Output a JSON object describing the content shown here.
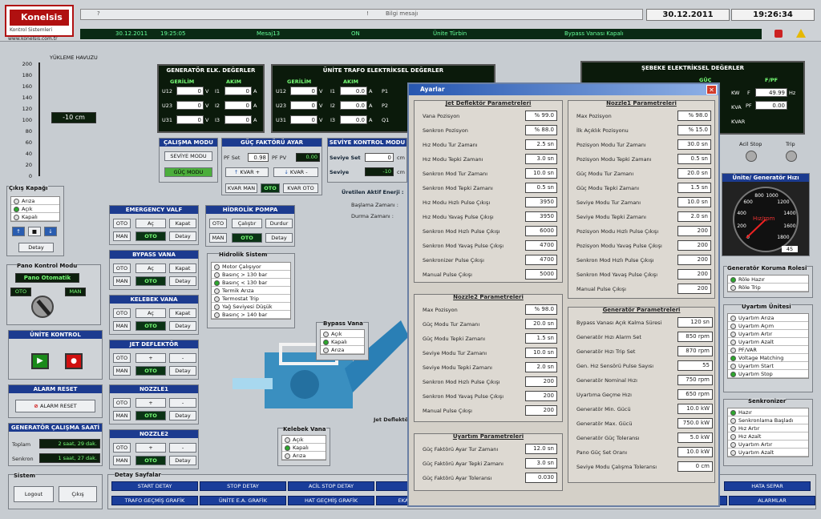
{
  "header": {
    "logo": "Konelsis",
    "logo_sub": "Kontrol Sistemleri",
    "website": "www.konelsis.com.tr",
    "message": "Bilgi mesajı",
    "date": "30.12.2011",
    "time": "19:26:34"
  },
  "alarmbar": {
    "date": "30.12.2011",
    "time": "19:25:05",
    "msg": "Mesaj13",
    "state": "ON",
    "unit": "Ünite Türbin",
    "desc": "Bypass Vanası Kapalı"
  },
  "left": {
    "reservoir_title": "YÜKLEME HAVUZU",
    "reservoir_ticks": [
      "200",
      "180",
      "160",
      "140",
      "120",
      "100",
      "80",
      "60",
      "40",
      "20",
      "0"
    ],
    "level": "-10 cm",
    "cikis_title": "Çıkış Kapağı",
    "cikis": [
      "Arıza",
      "Açık",
      "Kapalı"
    ],
    "cikis_btn": "Detay",
    "pano_title": "Pano Kontrol Modu",
    "pano_mode": "Pano Otomatik",
    "oto": "OTO",
    "man": "MAN",
    "unite_title": "ÜNİTE KONTROL",
    "alarm_title": "ALARM RESET",
    "alarm_btn": "ALARM RESET",
    "gen_title": "GENERATÖR ÇALIŞMA SAATİ",
    "toplam": "Toplam",
    "toplam_val": "2 saat, 29 dak.",
    "senkron": "Senkron",
    "senkron_val": "1 saat, 27 dak.",
    "sistem_title": "Sistem",
    "logout": "Logout",
    "cikis_btn2": "Çıkış"
  },
  "gen_elk": {
    "title": "GENERATÖR ELK. DEĞERLER",
    "gerilim": "GERİLİM",
    "akim": "AKIM",
    "rows": [
      {
        "l": "U12",
        "v": "0",
        "u": "V",
        "al": "I1",
        "av": "0",
        "au": "A"
      },
      {
        "l": "U23",
        "v": "0",
        "u": "V",
        "al": "I2",
        "av": "0",
        "au": "A"
      },
      {
        "l": "U31",
        "v": "0",
        "u": "V",
        "al": "I3",
        "av": "0",
        "au": "A"
      }
    ]
  },
  "trafo": {
    "title": "ÜNİTE TRAFO ELEKTRİKSEL DEĞERLER",
    "gerilim": "GERİLİM",
    "akim": "AKIM",
    "rows": [
      {
        "l": "U12",
        "v": "0",
        "u": "V",
        "al": "I1",
        "av": "0.0",
        "au": "A",
        "pl": "P1"
      },
      {
        "l": "U23",
        "v": "0",
        "u": "V",
        "al": "I2",
        "av": "0.0",
        "au": "A",
        "pl": "P2"
      },
      {
        "l": "U31",
        "v": "0",
        "u": "V",
        "al": "I3",
        "av": "0.0",
        "au": "A",
        "pl": "Q1"
      }
    ]
  },
  "sebeke": {
    "title": "ŞEBEKE ELEKTRİKSEL DEĞERLER",
    "gerilim": "GERİLİM",
    "akim": "AKIM",
    "guc": "GÜÇ",
    "fpf": "F/PF",
    "units": [
      "KW",
      "KVA",
      "KVAR"
    ],
    "f_label": "F",
    "f_val": "49.99",
    "f_unit": "Hz",
    "pf_label": "PF",
    "pf_val": "0.00",
    "acil_stop": "Acil Stop",
    "trip": "Trip",
    "gauge_title": "Ünite/ Generatör Hızı",
    "gauge_label": "Hız/rpm",
    "gauge_ticks": [
      "0",
      "200",
      "400",
      "600",
      "800",
      "1000",
      "1200",
      "1400",
      "1600",
      "1800"
    ],
    "gauge_val": "45"
  },
  "calisma": {
    "title": "ÇALIŞMA MODU",
    "b1": "SEVİYE MODU",
    "b2": "GÜÇ MODU"
  },
  "guc_faktor": {
    "title": "GÜÇ FAKTÖRÜ AYAR",
    "pf_set": "PF Set",
    "pf_set_val": "0.98",
    "pf_pv": "PF PV",
    "pf_pv_val": "0.00",
    "kvar_up": "KVAR +",
    "kvar_down": "KVAR -",
    "kvar_man": "KVAR MAN",
    "oto": "OTO",
    "kvar_oto": "KVAR OTO"
  },
  "seviye": {
    "title": "SEVİYE KONTROL MODU",
    "set_l": "Seviye Set",
    "set_v": "0",
    "unit": "cm",
    "pv_l": "Seviye",
    "pv_v": "-10",
    "aktif": "Üretilen Aktif Enerji :",
    "baslama": "Başlama Zamanı :",
    "durma": "Durma Zamanı :"
  },
  "valves": [
    {
      "title": "EMERGENCY VALF",
      "b1": "OTO",
      "b2": "Aç",
      "b3": "Kapat",
      "b4": "MAN",
      "b5": "OTO",
      "b6": "Detay"
    },
    {
      "title": "BYPASS VANA",
      "b1": "OTO",
      "b2": "Aç",
      "b3": "Kapat",
      "b4": "MAN",
      "b5": "OTO",
      "b6": "Detay"
    },
    {
      "title": "KELEBEK VANA",
      "b1": "OTO",
      "b2": "Aç",
      "b3": "Kapat",
      "b4": "MAN",
      "b5": "OTO",
      "b6": "Detay"
    },
    {
      "title": "JET DEFLEKTÖR",
      "b1": "OTO",
      "b2": "+",
      "b3": "-",
      "b4": "MAN",
      "b5": "OTO",
      "b6": "Detay"
    },
    {
      "title": "NOZZLE1",
      "b1": "OTO",
      "b2": "+",
      "b3": "-",
      "b4": "MAN",
      "b5": "OTO",
      "b6": "Detay"
    },
    {
      "title": "NOZZLE2",
      "b1": "OTO",
      "b2": "+",
      "b3": "-",
      "b4": "MAN",
      "b5": "OTO",
      "b6": "Detay"
    }
  ],
  "hidrolik_pompa": {
    "title": "HİDROLİK POMPA",
    "b1": "OTO",
    "b2": "Çalıştır",
    "b3": "Durdur",
    "b4": "MAN",
    "b5": "OTO",
    "b6": "Detay"
  },
  "hidrolik_sistem": {
    "title": "Hidrolik Sistem",
    "items": [
      "Motor Çalışıyor",
      "Basınç > 130 bar",
      "Basınç < 130 bar",
      "Termik Arıza",
      "Termostat Trip",
      "Yağ Seviyesi Düşük",
      "Basınç > 140 bar"
    ]
  },
  "bypass_vana": {
    "title": "Bypass Vana",
    "items": [
      "Açık",
      "Kapalı",
      "Arıza"
    ]
  },
  "kelebek_vana": {
    "title": "Kelebek Vana",
    "items": [
      "Açık",
      "Kapalı",
      "Arıza"
    ]
  },
  "jet_label": "Jet Deflektör",
  "koruma": {
    "title": "Generatör Koruma Rolesi",
    "items": [
      "Röle Hazır",
      "Röle Trip"
    ]
  },
  "uyartim": {
    "title": "Uyartım Ünitesi",
    "items": [
      "Uyartım Arıza",
      "Uyartım Açım",
      "Uyartım Artır",
      "Uyartım Azalt",
      "PF/VAR",
      "Voltage Matching",
      "Uyartım Start",
      "Uyartım Stop"
    ]
  },
  "senkronizer": {
    "title": "Senkronizer",
    "items": [
      "Hazır",
      "Senkronlama Başladı",
      "Hız Artır",
      "Hız Azalt",
      "Uyartım Artır",
      "Uyartım Azalt"
    ]
  },
  "dialog": {
    "title": "Ayarlar",
    "jet": {
      "title": "Jet Deflektör Parametreleri",
      "rows": [
        [
          "Vana Pozisyon",
          "% 99.0"
        ],
        [
          "Senkron Pozisyon",
          "% 88.0"
        ],
        [
          "Hız Modu Tur Zamanı",
          "2.5 sn"
        ],
        [
          "Hız Modu Tepki Zamanı",
          "3.0 sn"
        ],
        [
          "Senkron Mod Tur Zamanı",
          "10.0 sn"
        ],
        [
          "Senkron Mod Tepki Zamanı",
          "0.5 sn"
        ],
        [
          "Hız Modu Hızlı Pulse Çıkışı",
          "3950"
        ],
        [
          "Hız Modu Yavaş Pulse Çıkışı",
          "3950"
        ],
        [
          "Senkron Mod Hızlı Pulse Çıkışı",
          "6000"
        ],
        [
          "Senkron Mod Yavaş Pulse Çıkışı",
          "4700"
        ],
        [
          "Senkronizer Pulse Çıkışı",
          "4700"
        ],
        [
          "Manual Pulse Çıkışı",
          "5000"
        ]
      ]
    },
    "nozzle1": {
      "title": "Nozzle1 Parametreleri",
      "rows": [
        [
          "Max Pozisyon",
          "% 98.0"
        ],
        [
          "İlk Açıklık Pozisyonu",
          "% 15.0"
        ],
        [
          "Pozisyon Modu Tur Zamanı",
          "30.0 sn"
        ],
        [
          "Pozisyon Modu Tepki Zamanı",
          "0.5 sn"
        ],
        [
          "Güç Modu Tur Zamanı",
          "20.0 sn"
        ],
        [
          "Güç Modu Tepki Zamanı",
          "1.5 sn"
        ],
        [
          "Seviye Modu Tur Zamanı",
          "10.0 sn"
        ],
        [
          "Seviye Modu Tepki Zamanı",
          "2.0 sn"
        ],
        [
          "Pozisyon Modu Hızlı Pulse Çıkışı",
          "200"
        ],
        [
          "Pozisyon Modu Yavaş Pulse Çıkışı",
          "200"
        ],
        [
          "Senkron Mod Hızlı Pulse Çıkışı",
          "200"
        ],
        [
          "Senkron Mod Yavaş Pulse Çıkışı",
          "200"
        ],
        [
          "Manual Pulse Çıkışı",
          "200"
        ]
      ]
    },
    "nozzle2": {
      "title": "Nozzle2 Parametreleri",
      "rows": [
        [
          "Max Pozisyon",
          "% 98.0"
        ],
        [
          "Güç Modu Tur Zamanı",
          "20.0 sn"
        ],
        [
          "Güç Modu Tepki Zamanı",
          "1.5 sn"
        ],
        [
          "Seviye Modu Tur Zamanı",
          "10.0 sn"
        ],
        [
          "Seviye Modu Tepki Zamanı",
          "2.0 sn"
        ],
        [
          "Senkron Mod Hızlı Pulse Çıkışı",
          "200"
        ],
        [
          "Senkron Mod Yavaş Pulse Çıkışı",
          "200"
        ],
        [
          "Manual Pulse Çıkışı",
          "200"
        ]
      ]
    },
    "generator": {
      "title": "Generatör Parametreleri",
      "rows": [
        [
          "Bypass Vanası Açık Kalma Süresi",
          "120 sn"
        ],
        [
          "Generatör Hızı Alarm Set",
          "850 rpm"
        ],
        [
          "Generatör Hızı Trip Set",
          "870 rpm"
        ],
        [
          "Gen. Hız Sensörü Pulse Sayısı",
          "55"
        ],
        [
          "Generatör Nominal Hızı",
          "750 rpm"
        ],
        [
          "Uyartıma Geçme Hızı",
          "650 rpm"
        ],
        [
          "Generatör Min. Gücü",
          "10.0 kW"
        ],
        [
          "Generatör Max. Gücü",
          "750.0 kW"
        ],
        [
          "Generatör Güç Toleransı",
          "5.0 kW"
        ],
        [
          "Pano Güç Set Oranı",
          "10.0 kW"
        ],
        [
          "Seviye Modu Çalışma Toleransı",
          "0 cm"
        ]
      ]
    },
    "uyartim": {
      "title": "Uyartım Parametreleri",
      "rows": [
        [
          "Güç Faktörü Ayar Tur Zamanı",
          "12.0 sn"
        ],
        [
          "Güç Faktörü Ayar Tepki Zamanı",
          "3.0 sn"
        ],
        [
          "Güç Faktörü Ayar Toleransı",
          "0.030"
        ]
      ]
    }
  },
  "detay": {
    "title": "Detay Sayfalar",
    "row1": [
      "START DETAY",
      "STOP DETAY",
      "ACİL STOP DETAY",
      "",
      "",
      "",
      "",
      "",
      "",
      "",
      "AYARLAR"
    ],
    "row1_last": "HATA SEPAR",
    "row2": [
      "TRAFO GEÇMİŞ GRAFİK",
      "ÜNİTE E.A. GRAFİK",
      "HAT GEÇMİŞ GRAFİK",
      "EKARLIK GRAFİK",
      "PROSES GRAFİK",
      "LOG KAYITLARI",
      "RAPORLAR",
      "ALARMLAR"
    ]
  }
}
